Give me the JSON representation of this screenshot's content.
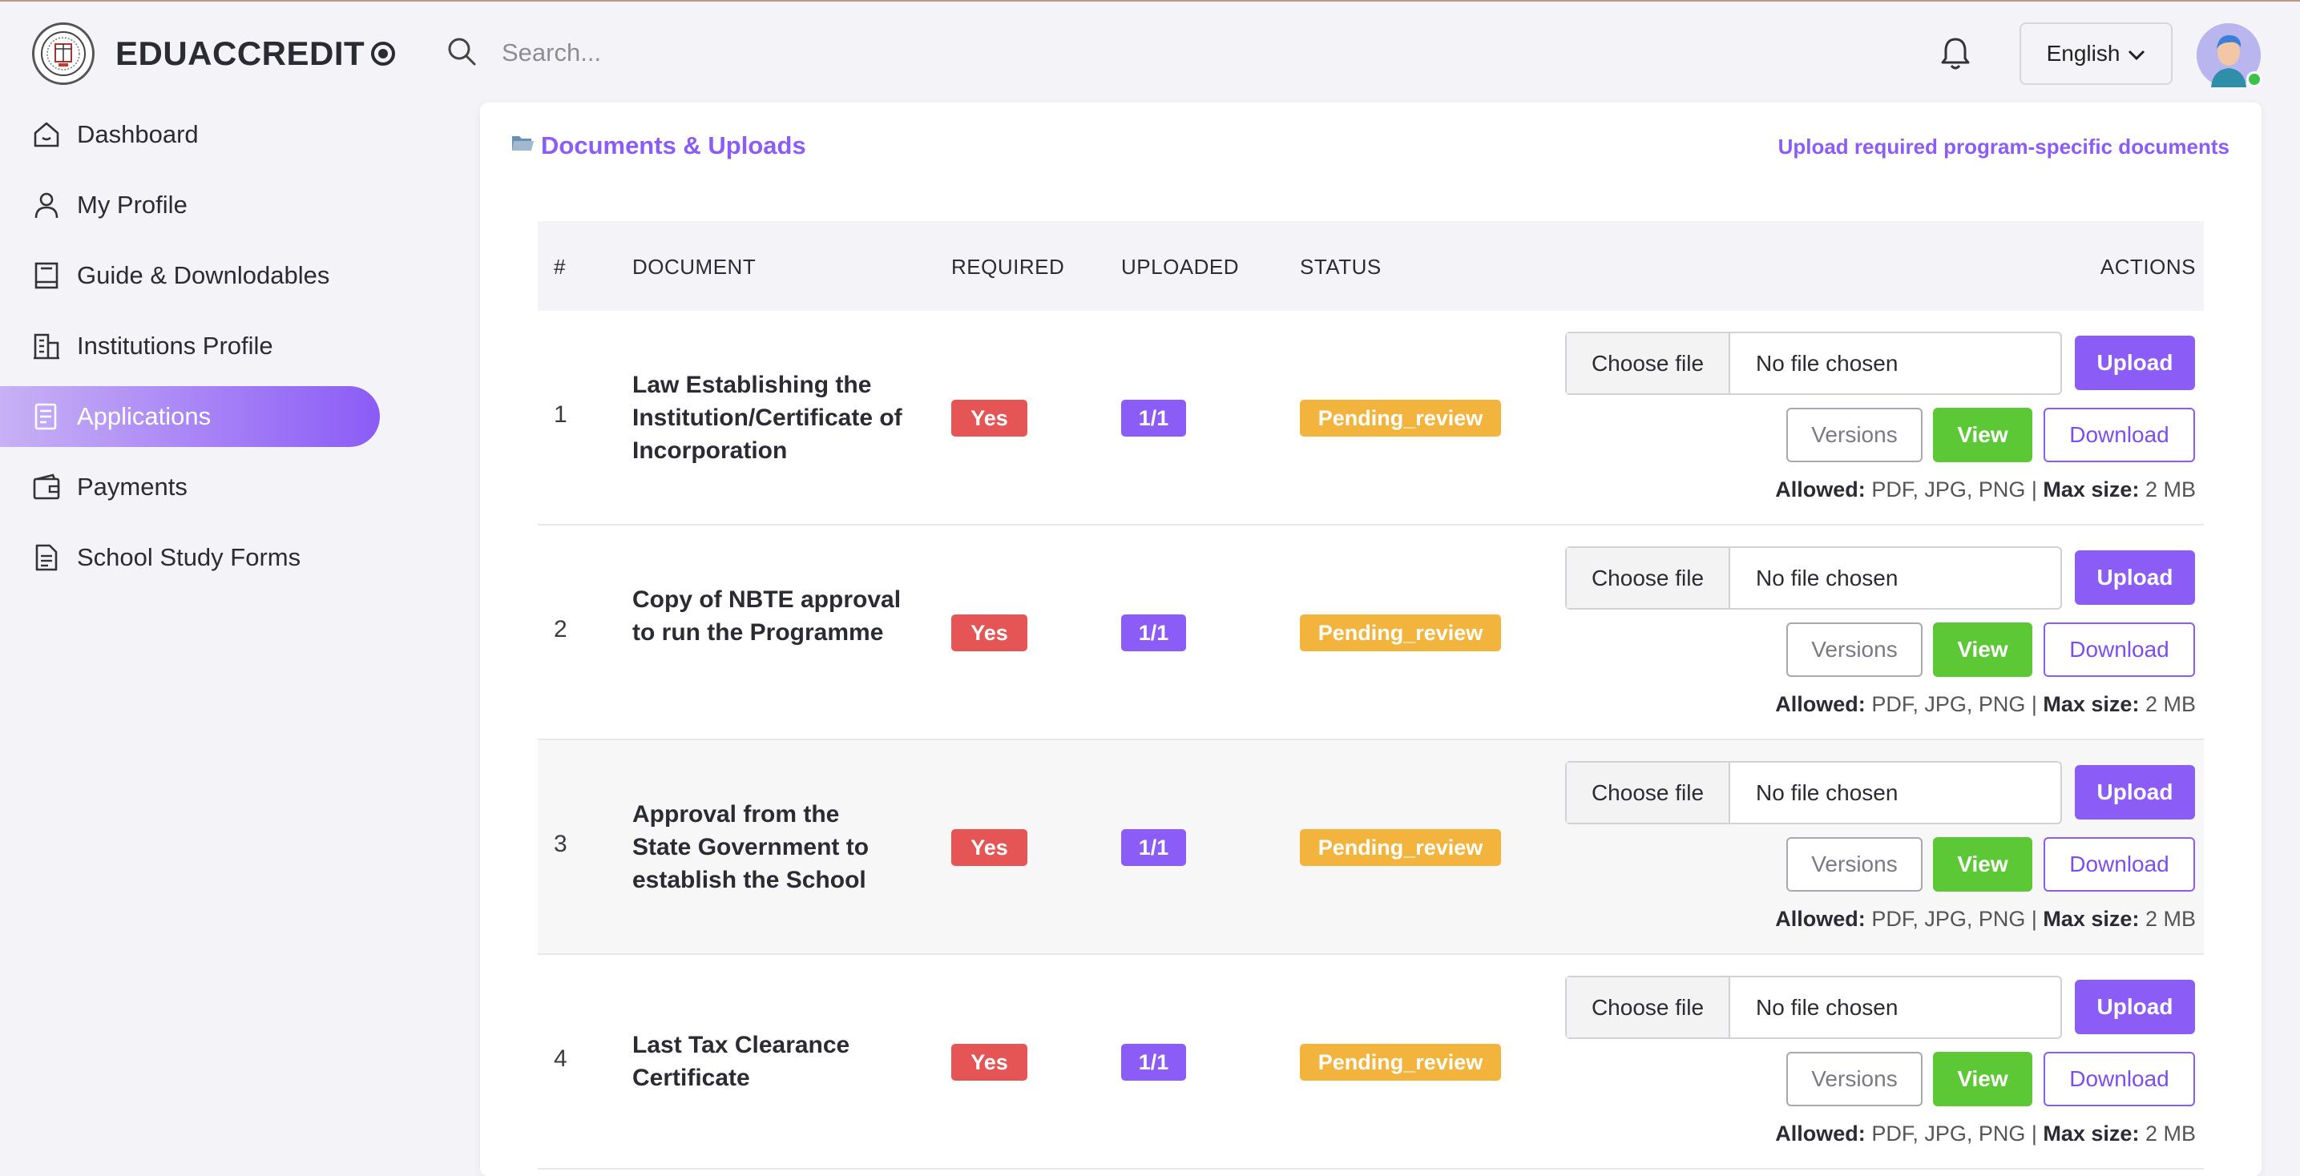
{
  "brand": {
    "name": "EDUACCREDIT"
  },
  "search": {
    "placeholder": "Search..."
  },
  "header": {
    "language": "English"
  },
  "sidebar": {
    "items": [
      {
        "label": "Dashboard",
        "icon": "home-icon"
      },
      {
        "label": "My Profile",
        "icon": "user-icon"
      },
      {
        "label": "Guide & Downlodables",
        "icon": "book-icon"
      },
      {
        "label": "Institutions Profile",
        "icon": "building-icon"
      },
      {
        "label": "Applications",
        "icon": "file-list-icon",
        "active": true
      },
      {
        "label": "Payments",
        "icon": "wallet-icon"
      },
      {
        "label": "School Study Forms",
        "icon": "document-icon"
      }
    ]
  },
  "card": {
    "title": "Documents & Uploads",
    "subtitle": "Upload required program-specific documents"
  },
  "table": {
    "headers": {
      "num": "#",
      "document": "DOCUMENT",
      "required": "REQUIRED",
      "uploaded": "UPLOADED",
      "status": "STATUS",
      "actions": "ACTIONS"
    },
    "rows": [
      {
        "num": "1",
        "document": "Law Establishing the Institution/Certificate of Incorporation",
        "required": "Yes",
        "uploaded": "1/1",
        "status": "Pending_review"
      },
      {
        "num": "2",
        "document": "Copy of NBTE approval to run the Programme",
        "required": "Yes",
        "uploaded": "1/1",
        "status": "Pending_review"
      },
      {
        "num": "3",
        "document": "Approval from the State Government to establish the School",
        "required": "Yes",
        "uploaded": "1/1",
        "status": "Pending_review"
      },
      {
        "num": "4",
        "document": "Last Tax Clearance Certificate",
        "required": "Yes",
        "uploaded": "1/1",
        "status": "Pending_review"
      }
    ]
  },
  "actions": {
    "choose_file": "Choose file",
    "no_file": "No file chosen",
    "upload": "Upload",
    "versions": "Versions",
    "view": "View",
    "download": "Download",
    "allowed_label": "Allowed:",
    "allowed_types": "PDF, JPG, PNG",
    "max_label": "Max size:",
    "max_size": "2 MB"
  },
  "colors": {
    "accent": "#8b5cf6",
    "danger": "#e65555",
    "warning": "#f3b43d",
    "success": "#5cc836"
  }
}
